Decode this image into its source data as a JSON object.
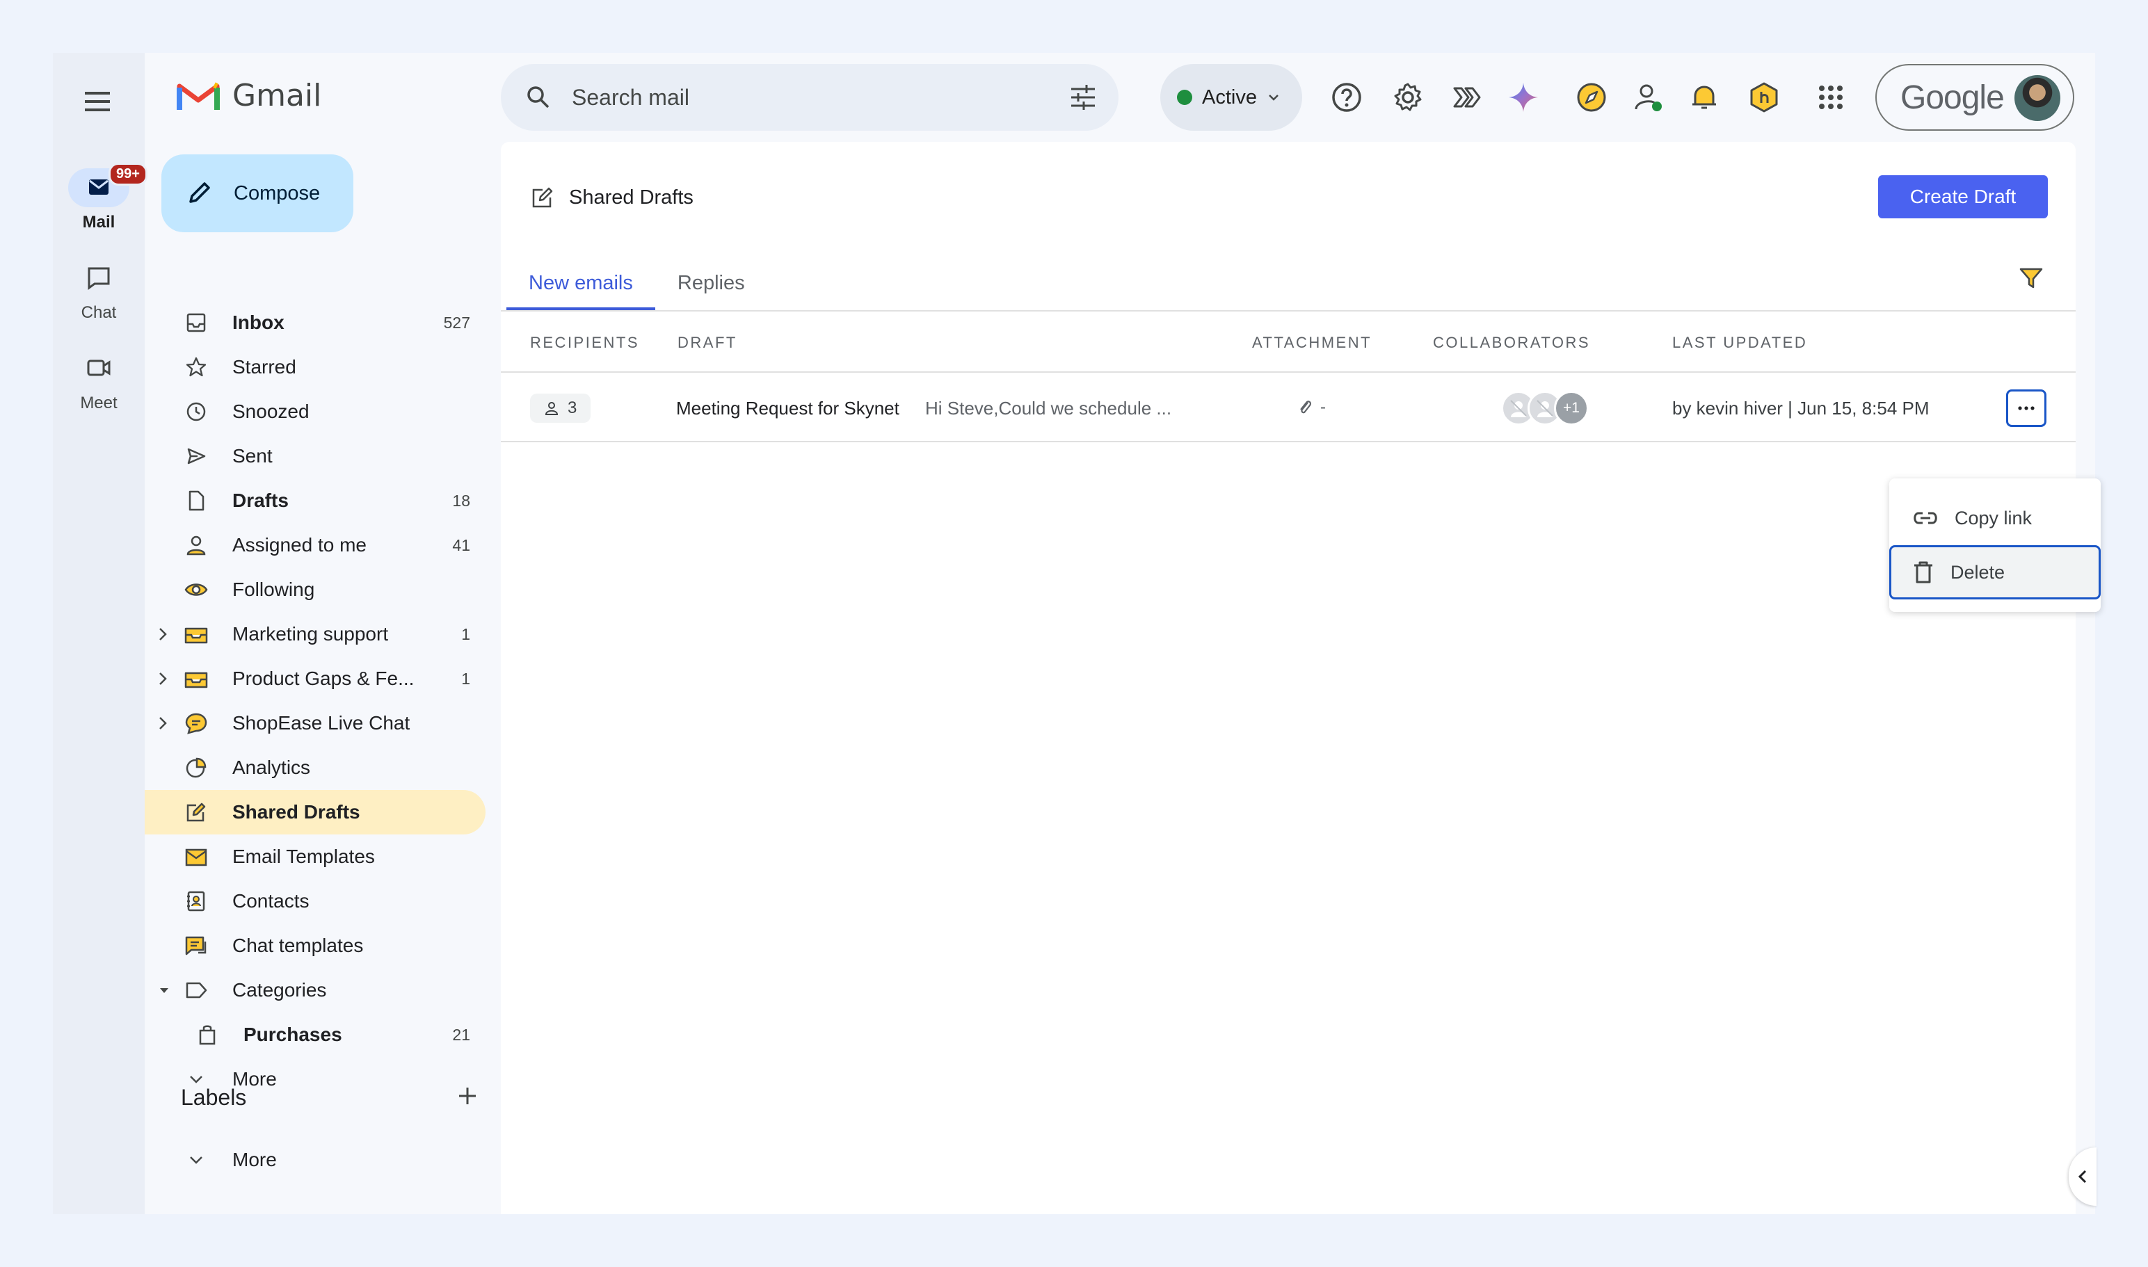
{
  "rail": {
    "items": [
      {
        "label": "Mail",
        "badge": "99+"
      },
      {
        "label": "Chat"
      },
      {
        "label": "Meet"
      }
    ]
  },
  "brand": {
    "name": "Gmail"
  },
  "compose": {
    "label": "Compose"
  },
  "nav": {
    "items": [
      {
        "label": "Inbox",
        "count": "527"
      },
      {
        "label": "Starred",
        "count": ""
      },
      {
        "label": "Snoozed",
        "count": ""
      },
      {
        "label": "Sent",
        "count": ""
      },
      {
        "label": "Drafts",
        "count": "18"
      },
      {
        "label": "Assigned to me",
        "count": "41"
      },
      {
        "label": "Following",
        "count": ""
      },
      {
        "label": "Marketing support",
        "count": "1"
      },
      {
        "label": "Product Gaps & Fe...",
        "count": "1"
      },
      {
        "label": "ShopEase Live Chat",
        "count": ""
      },
      {
        "label": "Analytics",
        "count": ""
      },
      {
        "label": "Shared Drafts",
        "count": ""
      },
      {
        "label": "Email Templates",
        "count": ""
      },
      {
        "label": "Contacts",
        "count": ""
      },
      {
        "label": "Chat templates",
        "count": ""
      },
      {
        "label": "Categories",
        "count": ""
      },
      {
        "label": "Purchases",
        "count": "21"
      },
      {
        "label": "More",
        "count": ""
      }
    ]
  },
  "labels": {
    "title": "Labels",
    "more": "More"
  },
  "search": {
    "placeholder": "Search mail"
  },
  "status": {
    "label": "Active",
    "color": "#1e8e3e"
  },
  "account": {
    "word": "Google"
  },
  "page": {
    "title": "Shared Drafts",
    "create_label": "Create Draft"
  },
  "tabs": [
    {
      "label": "New emails",
      "active": true
    },
    {
      "label": "Replies",
      "active": false
    }
  ],
  "table": {
    "headers": [
      "RECIPIENTS",
      "DRAFT",
      "ATTACHMENT",
      "COLLABORATORS",
      "LAST UPDATED"
    ],
    "rows": [
      {
        "recipients": "3",
        "subject": "Meeting Request for Skynet",
        "snippet": "Hi Steve,Could we schedule ...",
        "attachment": "-",
        "collab_more": "+1",
        "updated": "by kevin hiver | Jun 15, 8:54 PM"
      }
    ]
  },
  "menu": {
    "copy": "Copy link",
    "delete": "Delete"
  },
  "colors": {
    "accent": "#4a62f0",
    "selected_nav": "#feefc3",
    "compose_bg": "#c2e7ff"
  }
}
